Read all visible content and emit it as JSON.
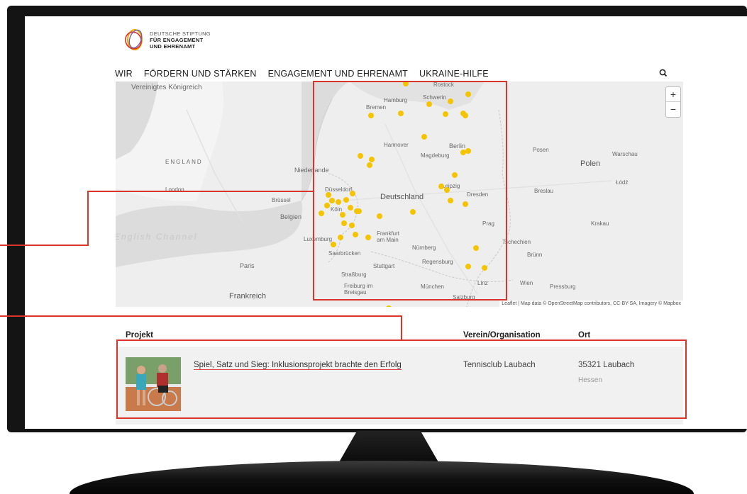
{
  "logo": {
    "line1": "DEUTSCHE STIFTUNG",
    "line2": "FÜR ENGAGEMENT",
    "line3": "UND EHRENAMT"
  },
  "nav": {
    "items": [
      "WIR",
      "FÖRDERN UND STÄRKEN",
      "ENGAGEMENT UND EHRENAMT",
      "UKRAINE-HILFE"
    ]
  },
  "map": {
    "zoom_in": "+",
    "zoom_out": "−",
    "attribution": "Leaflet | Map data © OpenStreetMap contributors, CC-BY-SA, Imagery © Mapbox",
    "labels": {
      "uk": "Vereinigtes Königreich",
      "london": "London",
      "england": "ENGLAND",
      "niederlande": "Niederlande",
      "belgien": "Belgien",
      "deutschland": "Deutschland",
      "polen": "Polen",
      "frankreich": "Frankreich",
      "paris": "Paris",
      "berlin": "Berlin",
      "hamburg": "Hamburg",
      "hannover": "Hannover",
      "frankfurt": "Frankfurt am Main",
      "muenchen": "München",
      "stuttgart": "Stuttgart",
      "nuernberg": "Nürnberg",
      "dresden": "Dresden",
      "leipzig": "Leipzig",
      "magdeburg": "Magdeburg",
      "bremen": "Bremen",
      "prag": "Prag",
      "tschechien": "Tschechien",
      "warschau": "Warschau",
      "wien": "Wien",
      "luxemburg": "Luxemburg",
      "koeln": "Köln",
      "duesseldorf": "Düsseldorf",
      "english_channel": "English Channel",
      "bruessel": "Brüssel",
      "schwerin": "Schwerin",
      "rostock": "Rostock",
      "krakau": "Krakau",
      "saarbruecken": "Saarbrücken",
      "strasbourg": "Straßburg",
      "freiburg": "Freiburg im Breisgau",
      "regensburg": "Regensburg",
      "linz": "Linz",
      "salzburg": "Salzburg",
      "pressburg": "Pressburg",
      "bruenn": "Brünn",
      "breslau": "Breslau",
      "posen": "Posen",
      "lodz": "Łódź"
    },
    "marker_color": "#f5c400"
  },
  "table": {
    "headers": {
      "project": "Projekt",
      "org": "Verein/Organisation",
      "place": "Ort"
    },
    "rows": [
      {
        "project": "Spiel, Satz und Sieg: Inklusionsprojekt brachte den Erfolg",
        "org": "Tennisclub Laubach",
        "place": "35321 Laubach",
        "region": "Hessen"
      }
    ]
  },
  "colors": {
    "annotation": "#d9362b",
    "link_underline": "#d94040"
  }
}
